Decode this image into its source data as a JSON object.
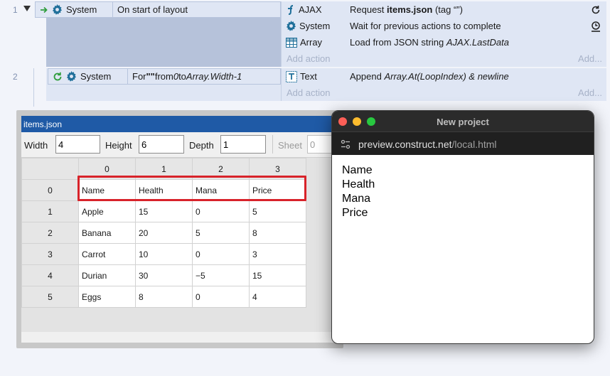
{
  "event_sheet": {
    "row1": {
      "number": "1",
      "condition_object": "System",
      "condition_text": "On start of layout",
      "actions": [
        {
          "object": "AJAX",
          "desc_pre": "Request ",
          "desc_bold": "items.json",
          "desc_post": " (tag “”)",
          "right_icon": "reload-icon"
        },
        {
          "object": "System",
          "desc": "Wait for previous actions to complete",
          "right_icon": "timer-icon"
        },
        {
          "object": "Array",
          "desc_pre": "Load from JSON string ",
          "desc_italic": "AJAX.LastData"
        }
      ],
      "add_action": "Add action",
      "add_more": "Add..."
    },
    "row2": {
      "number": "2",
      "condition_object": "System",
      "condition_pre": "For ",
      "condition_bold": "\"\"",
      "condition_mid1": " from ",
      "condition_it1": "0",
      "condition_mid2": " to ",
      "condition_it2": "Array.Width-1",
      "actions": [
        {
          "object": "Text",
          "desc_pre": "Append ",
          "desc_italic": "Array.At(LoopIndex) & newline"
        }
      ],
      "add_action": "Add action",
      "add_more": "Add..."
    }
  },
  "array_editor": {
    "title": "items.json",
    "width_label": "Width",
    "width_value": "4",
    "height_label": "Height",
    "height_value": "6",
    "depth_label": "Depth",
    "depth_value": "1",
    "sheet_label": "Sheet",
    "sheet_value": "0",
    "column_headers": [
      "0",
      "1",
      "2",
      "3"
    ],
    "rows": [
      {
        "index": "0",
        "cells": [
          "Name",
          "Health",
          "Mana",
          "Price"
        ]
      },
      {
        "index": "1",
        "cells": [
          "Apple",
          "15",
          "0",
          "5"
        ]
      },
      {
        "index": "2",
        "cells": [
          "Banana",
          "20",
          "5",
          "8"
        ]
      },
      {
        "index": "3",
        "cells": [
          "Carrot",
          "10",
          "0",
          "3"
        ]
      },
      {
        "index": "4",
        "cells": [
          "Durian",
          "30",
          "−5",
          "15"
        ]
      },
      {
        "index": "5",
        "cells": [
          "Eggs",
          "8",
          "0",
          "4"
        ]
      }
    ],
    "highlight_color": "#d8232a"
  },
  "browser": {
    "title": "New project",
    "url_host": "preview.construct.net",
    "url_path": "/local.html",
    "lines": [
      "Name",
      "Health",
      "Mana",
      "Price"
    ]
  }
}
